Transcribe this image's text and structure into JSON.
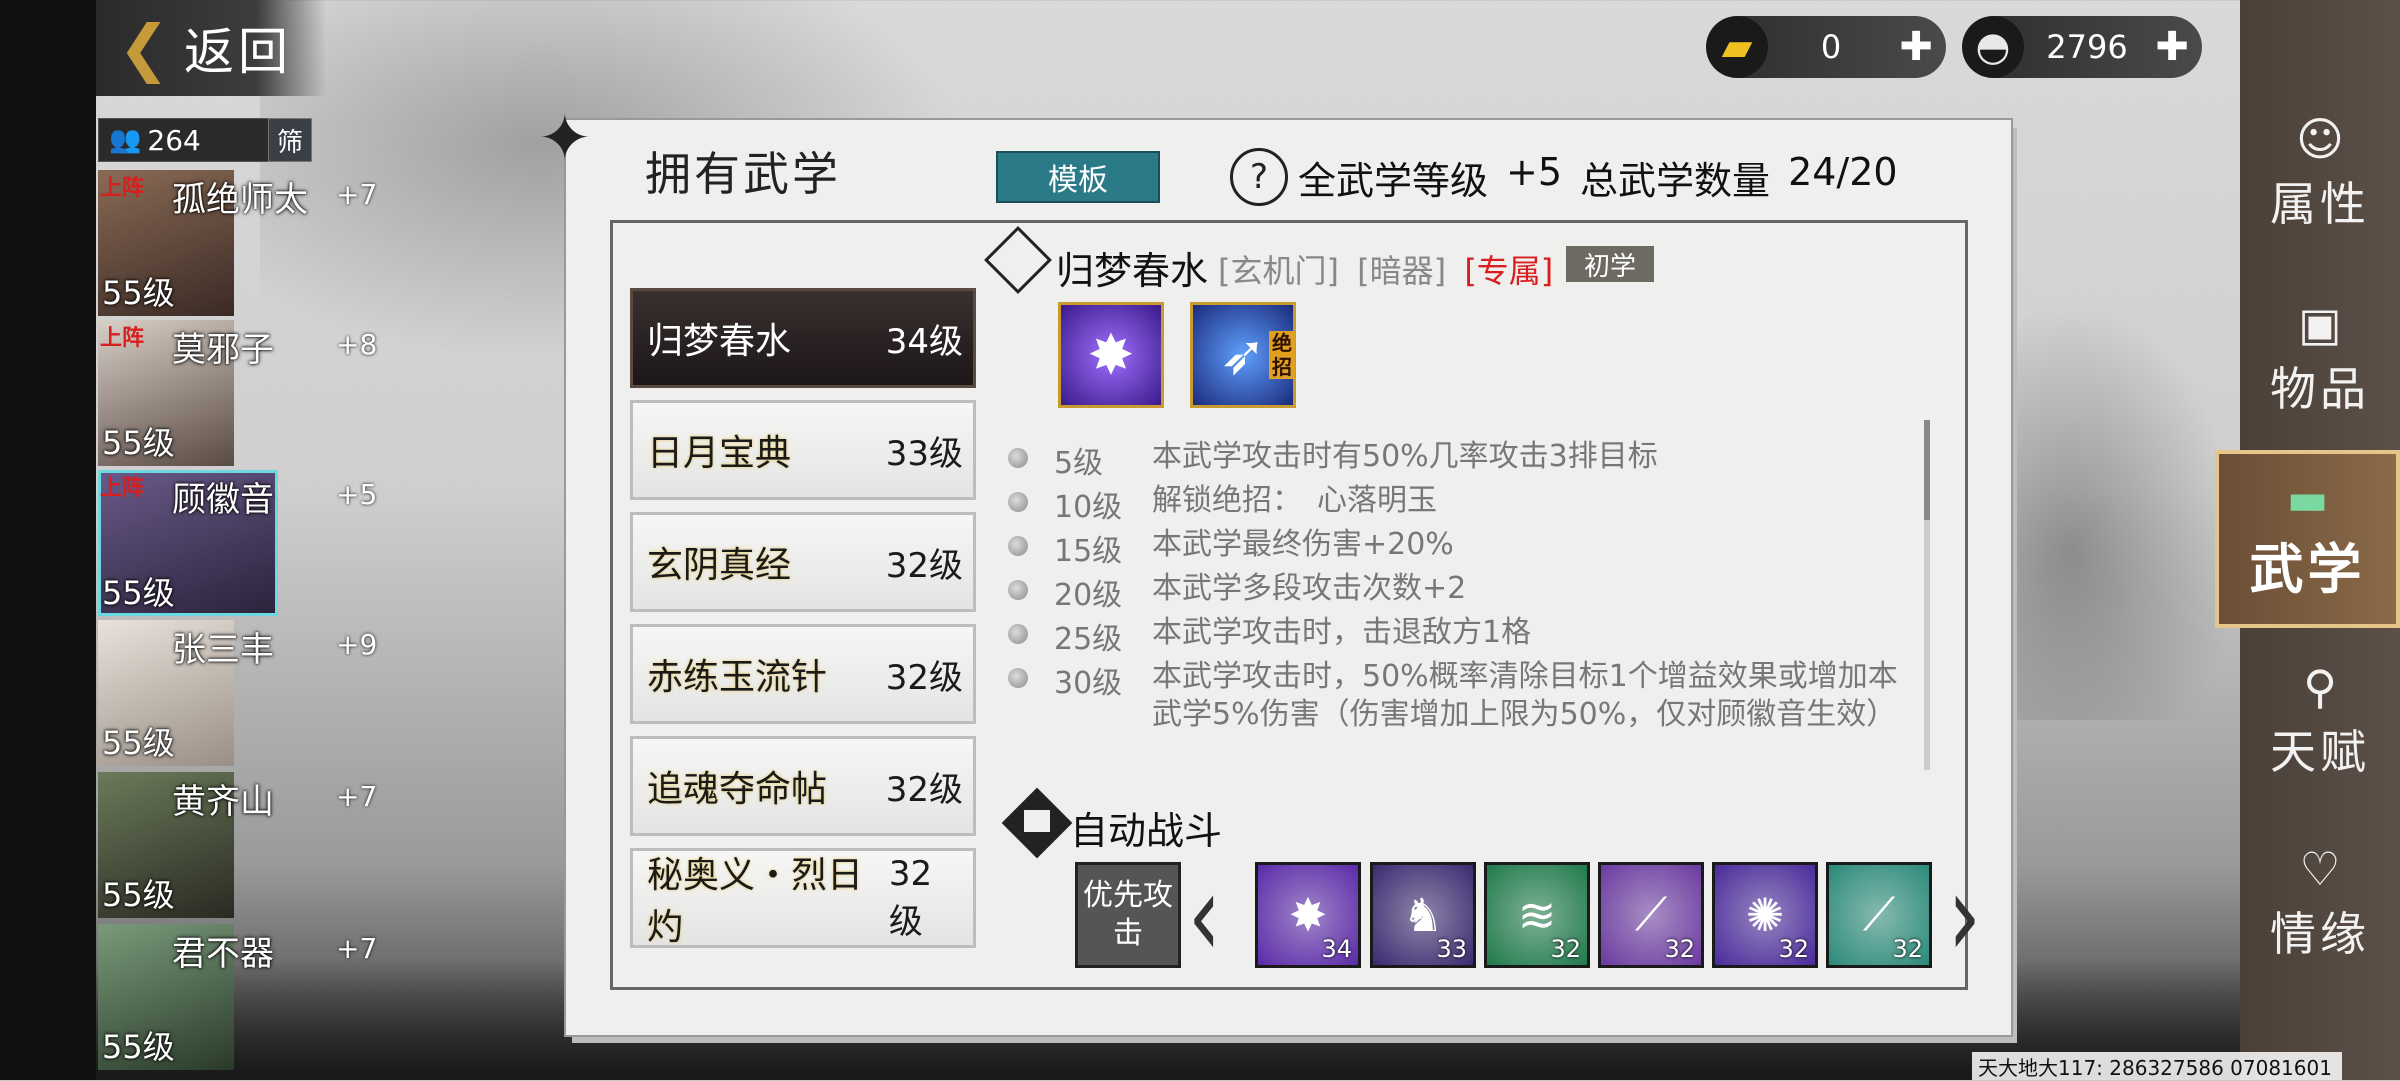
{
  "header": {
    "back_label": "返回"
  },
  "roster": {
    "count": "264",
    "filter_label": "筛",
    "characters": [
      {
        "deploy": "上阵",
        "name": "孤绝师太",
        "bonus": "+7",
        "level": "55级"
      },
      {
        "deploy": "上阵",
        "name": "莫邪子",
        "bonus": "+8",
        "level": "55级"
      },
      {
        "deploy": "上阵",
        "name": "顾徽音",
        "bonus": "+5",
        "level": "55级"
      },
      {
        "deploy": "",
        "name": "张三丰",
        "bonus": "+9",
        "level": "55级"
      },
      {
        "deploy": "",
        "name": "黄齐山",
        "bonus": "+7",
        "level": "55级"
      },
      {
        "deploy": "",
        "name": "君不器",
        "bonus": "+7",
        "level": "55级"
      }
    ]
  },
  "currency": {
    "gold": "0",
    "silver": "2796"
  },
  "right_menu": {
    "items": [
      "属性",
      "物品",
      "武学",
      "天赋",
      "情缘"
    ],
    "selected": "武学"
  },
  "panel": {
    "title": "拥有武学",
    "template_label": "模板",
    "total_level_label": "全武学等级",
    "total_level_value": "+5",
    "total_count_label": "总武学数量",
    "total_count_value": "24/20"
  },
  "skill_list": [
    {
      "name": "归梦春水",
      "level": "34级"
    },
    {
      "name": "日月宝典",
      "level": "33级"
    },
    {
      "name": "玄阴真经",
      "level": "32级"
    },
    {
      "name": "赤练玉流针",
      "level": "32级"
    },
    {
      "name": "追魂夺命帖",
      "level": "32级"
    },
    {
      "name": "秘奥义・烈日灼",
      "level": "32级"
    }
  ],
  "detail": {
    "name": "归梦春水",
    "tags": [
      "[玄机门]",
      "[暗器]"
    ],
    "exclusive_tag": "[专属]",
    "tier": "初学",
    "ult_tag": "绝招",
    "effects": [
      {
        "level": "5级",
        "desc": "本武学攻击时有50%几率攻击3排目标"
      },
      {
        "level": "10级",
        "desc": "解锁绝招：　心落明玉"
      },
      {
        "level": "15级",
        "desc": "本武学最终伤害+20%"
      },
      {
        "level": "20级",
        "desc": "本武学多段攻击次数+2"
      },
      {
        "level": "25级",
        "desc": "本武学攻击时，击退敌方1格"
      },
      {
        "level": "30级",
        "desc": "本武学攻击时，50%概率清除目标1个增益效果或增加本武学5%伤害（伤害增加上限为50%，仅对顾徽音生效）"
      }
    ]
  },
  "auto_battle": {
    "title": "自动战斗",
    "priority_label": "优先攻击",
    "skills": [
      {
        "level": "34",
        "color": "#5a2aa8"
      },
      {
        "level": "33",
        "color": "#3a2a70"
      },
      {
        "level": "32",
        "color": "#1f7a4a"
      },
      {
        "level": "32",
        "color": "#6a3aa0"
      },
      {
        "level": "32",
        "color": "#4a2a9a"
      },
      {
        "level": "32",
        "color": "#2a8a7a"
      }
    ]
  },
  "server_info": "天大地大117: 286327586  07081601"
}
